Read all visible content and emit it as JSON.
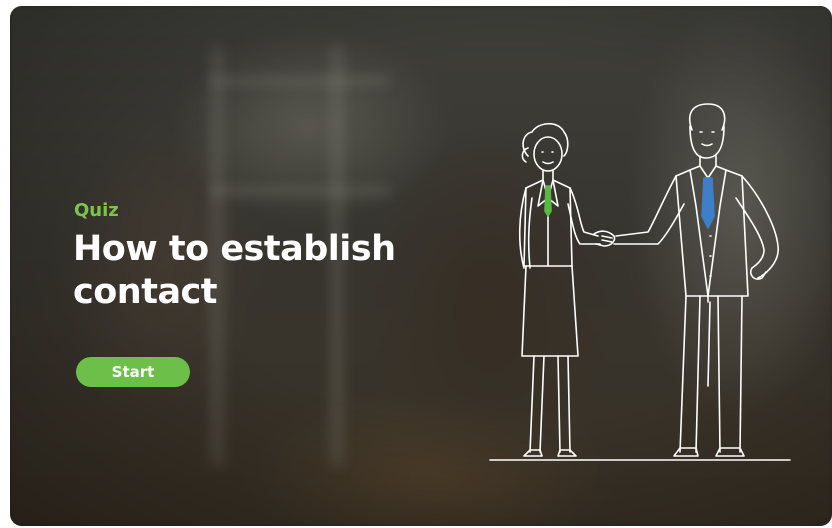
{
  "hero": {
    "eyebrow": "Quiz",
    "title": "How to establish contact",
    "start_label": "Start"
  },
  "colors": {
    "accent": "#6cc04a",
    "eyebrow": "#7cc44b",
    "tie_woman": "#5cb845",
    "tie_man": "#3f7fc8",
    "line": "#ffffff"
  },
  "illustration": {
    "subject": "handshake-illustration"
  }
}
